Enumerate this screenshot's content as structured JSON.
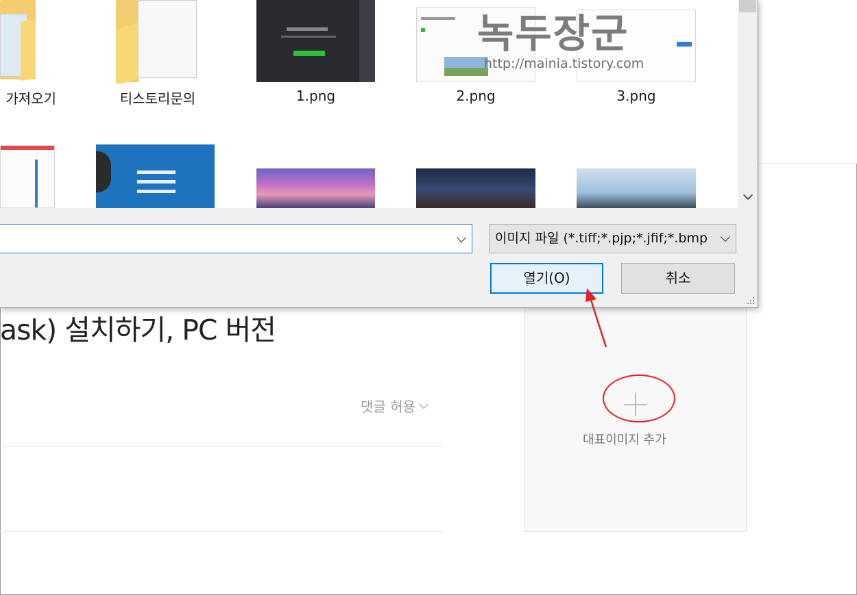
{
  "dialog": {
    "files": [
      {
        "name": "가져오기",
        "kind": "folder"
      },
      {
        "name": "티스토리문의",
        "kind": "folder"
      },
      {
        "name": "1.png",
        "kind": "image"
      },
      {
        "name": "2.png",
        "kind": "image"
      },
      {
        "name": "3.png",
        "kind": "image"
      }
    ],
    "filename_value": "",
    "filetype_selected": "이미지 파일 (*.tiff;*.pjp;*.jfif;*.bmp",
    "open_button": "열기(O)",
    "cancel_button": "취소"
  },
  "page": {
    "title_fragment": "ask) 설치하기, PC 버전",
    "comment_toggle": "댓글 허용",
    "rep_image_label": "대표이미지 추가"
  },
  "watermark": {
    "title": "녹두장군",
    "url": "http://mainia.tistory.com"
  },
  "colors": {
    "accent": "#0078d7",
    "annotation": "#e0202a",
    "folder": "#f8d775"
  }
}
